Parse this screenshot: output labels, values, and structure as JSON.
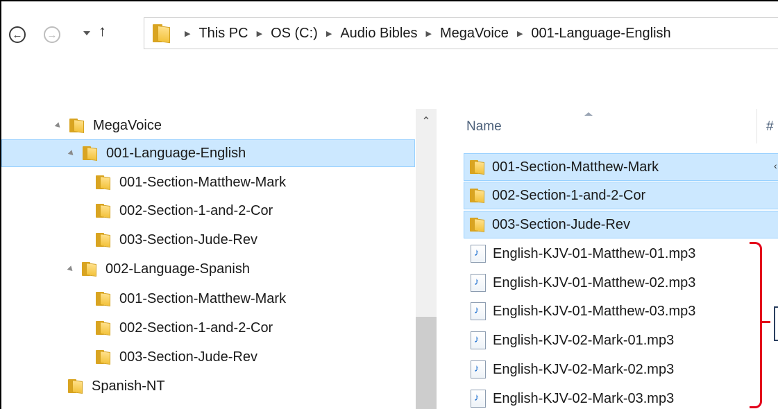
{
  "breadcrumb": [
    "This PC",
    "OS (C:)",
    "Audio Bibles",
    "MegaVoice",
    "001-Language-English"
  ],
  "nav": {
    "back_icon": "back-arrow-icon",
    "forward_icon": "forward-arrow-icon",
    "back_glyph": "←",
    "forward_glyph": "→",
    "up_glyph": "↑"
  },
  "tree": {
    "items": [
      {
        "label": "MegaVoice",
        "expanded": true,
        "selected": false
      },
      {
        "label": "001-Language-English",
        "expanded": true,
        "selected": true
      },
      {
        "label": "001-Section-Matthew-Mark"
      },
      {
        "label": "002-Section-1-and-2-Cor"
      },
      {
        "label": "003-Section-Jude-Rev"
      },
      {
        "label": "002-Language-Spanish",
        "expanded": true
      },
      {
        "label": "001-Section-Matthew-Mark"
      },
      {
        "label": "002-Section-1-and-2-Cor"
      },
      {
        "label": "003-Section-Jude-Rev"
      },
      {
        "label": "Spanish-NT"
      }
    ]
  },
  "files": {
    "headers": {
      "name": "Name",
      "number": "#"
    },
    "items": [
      {
        "name": "001-Section-Matthew-Mark",
        "type": "folder",
        "selected": true
      },
      {
        "name": "002-Section-1-and-2-Cor",
        "type": "folder",
        "selected": true
      },
      {
        "name": "003-Section-Jude-Rev",
        "type": "folder",
        "selected": true
      },
      {
        "name": "English-KJV-01-Matthew-01.mp3",
        "type": "mp3"
      },
      {
        "name": "English-KJV-01-Matthew-02.mp3",
        "type": "mp3"
      },
      {
        "name": "English-KJV-01-Matthew-03.mp3",
        "type": "mp3"
      },
      {
        "name": "English-KJV-02-Mark-01.mp3",
        "type": "mp3"
      },
      {
        "name": "English-KJV-02-Mark-02.mp3",
        "type": "mp3"
      },
      {
        "name": "English-KJV-02-Mark-03.mp3",
        "type": "mp3"
      }
    ]
  },
  "colors": {
    "selection": "#cce8ff",
    "selection_border": "#99d1ff",
    "annotation": "#e3001b",
    "folder": "#f3c33d"
  }
}
